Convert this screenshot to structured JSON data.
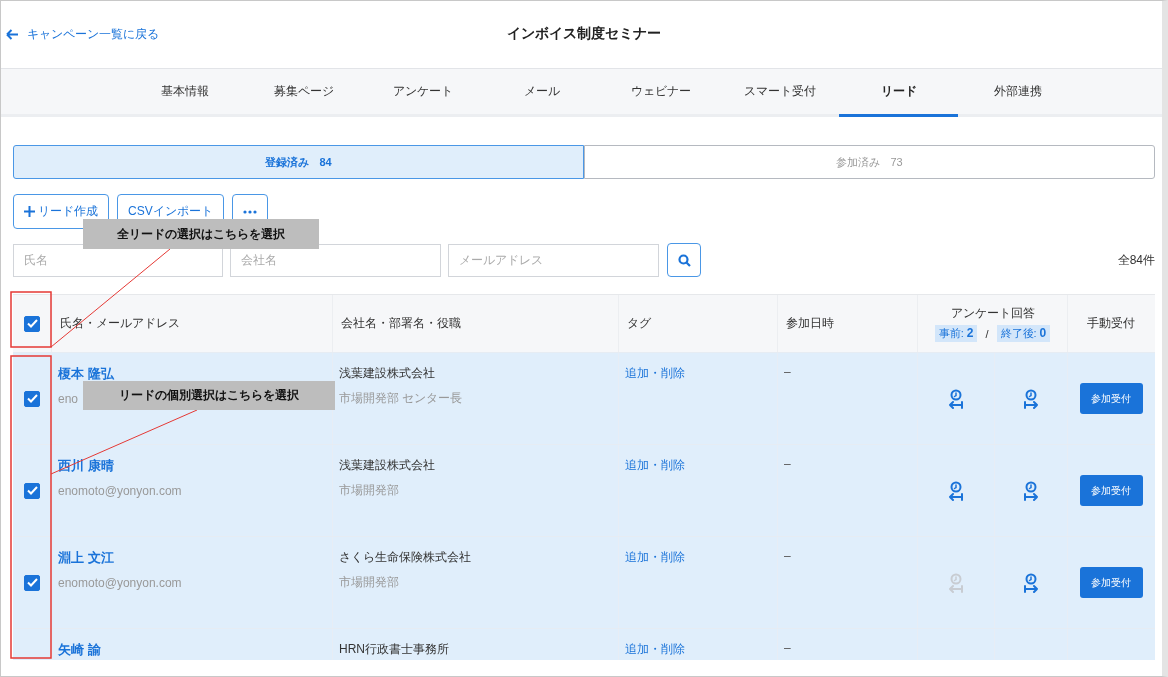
{
  "header": {
    "back_link": "キャンペーン一覧に戻る",
    "title": "インボイス制度セミナー"
  },
  "tabs": [
    {
      "label": "基本情報",
      "selected": false
    },
    {
      "label": "募集ページ",
      "selected": false
    },
    {
      "label": "アンケート",
      "selected": false
    },
    {
      "label": "メール",
      "selected": false
    },
    {
      "label": "ウェビナー",
      "selected": false
    },
    {
      "label": "スマート受付",
      "selected": false
    },
    {
      "label": "リード",
      "selected": true
    },
    {
      "label": "外部連携",
      "selected": false
    }
  ],
  "segments": [
    {
      "label": "登録済み",
      "count": "84",
      "selected": true
    },
    {
      "label": "参加済み",
      "count": "73",
      "selected": false
    }
  ],
  "actions": [
    {
      "kind": "create",
      "label": "リード作成"
    },
    {
      "kind": "import",
      "label": "CSVインポート"
    },
    {
      "kind": "more"
    }
  ],
  "filters": [
    {
      "placeholder": "氏名"
    },
    {
      "placeholder": "会社名"
    },
    {
      "placeholder": "メールアドレス"
    }
  ],
  "total": "全84件",
  "table": {
    "header_checked": true,
    "columns": [
      "氏名・メールアドレス",
      "会社名・部署名・役職",
      "タグ",
      "参加日時"
    ],
    "survey": {
      "title": "アンケート回答",
      "pre_label": "事前:",
      "pre_count": "2",
      "separator": "/",
      "post_label": "終了後:",
      "post_count": "0"
    },
    "manual_column": "手動受付",
    "rows": [
      {
        "selected": true,
        "checked": true,
        "name": "榎本 隆弘",
        "email": "eno",
        "company": "浅葉建設株式会社",
        "department": "市場開発部 センター長",
        "tag_link": "追加・削除",
        "joined": "–",
        "pre_answered": true,
        "post_answered": true,
        "button": "参加受付"
      },
      {
        "selected": true,
        "checked": true,
        "name": "西川 康晴",
        "email": "enomoto@yonyon.com",
        "company": "浅葉建設株式会社",
        "department": "市場開発部",
        "tag_link": "追加・削除",
        "joined": "–",
        "pre_answered": true,
        "post_answered": true,
        "button": "参加受付"
      },
      {
        "selected": true,
        "checked": true,
        "name": "淵上 文江",
        "email": "enomoto@yonyon.com",
        "company": "さくら生命保険株式会社",
        "department": "市場開発部",
        "tag_link": "追加・削除",
        "joined": "–",
        "pre_answered": false,
        "post_answered": true,
        "button": "参加受付"
      },
      {
        "selected": true,
        "name": "矢崎 諭",
        "company": "HRN行政書士事務所",
        "tag_link": "追加・削除",
        "joined": "–"
      }
    ]
  },
  "annotations": [
    {
      "text": "全リードの選択はこちらを選択"
    },
    {
      "text": "リードの個別選択はこちらを選択"
    }
  ]
}
